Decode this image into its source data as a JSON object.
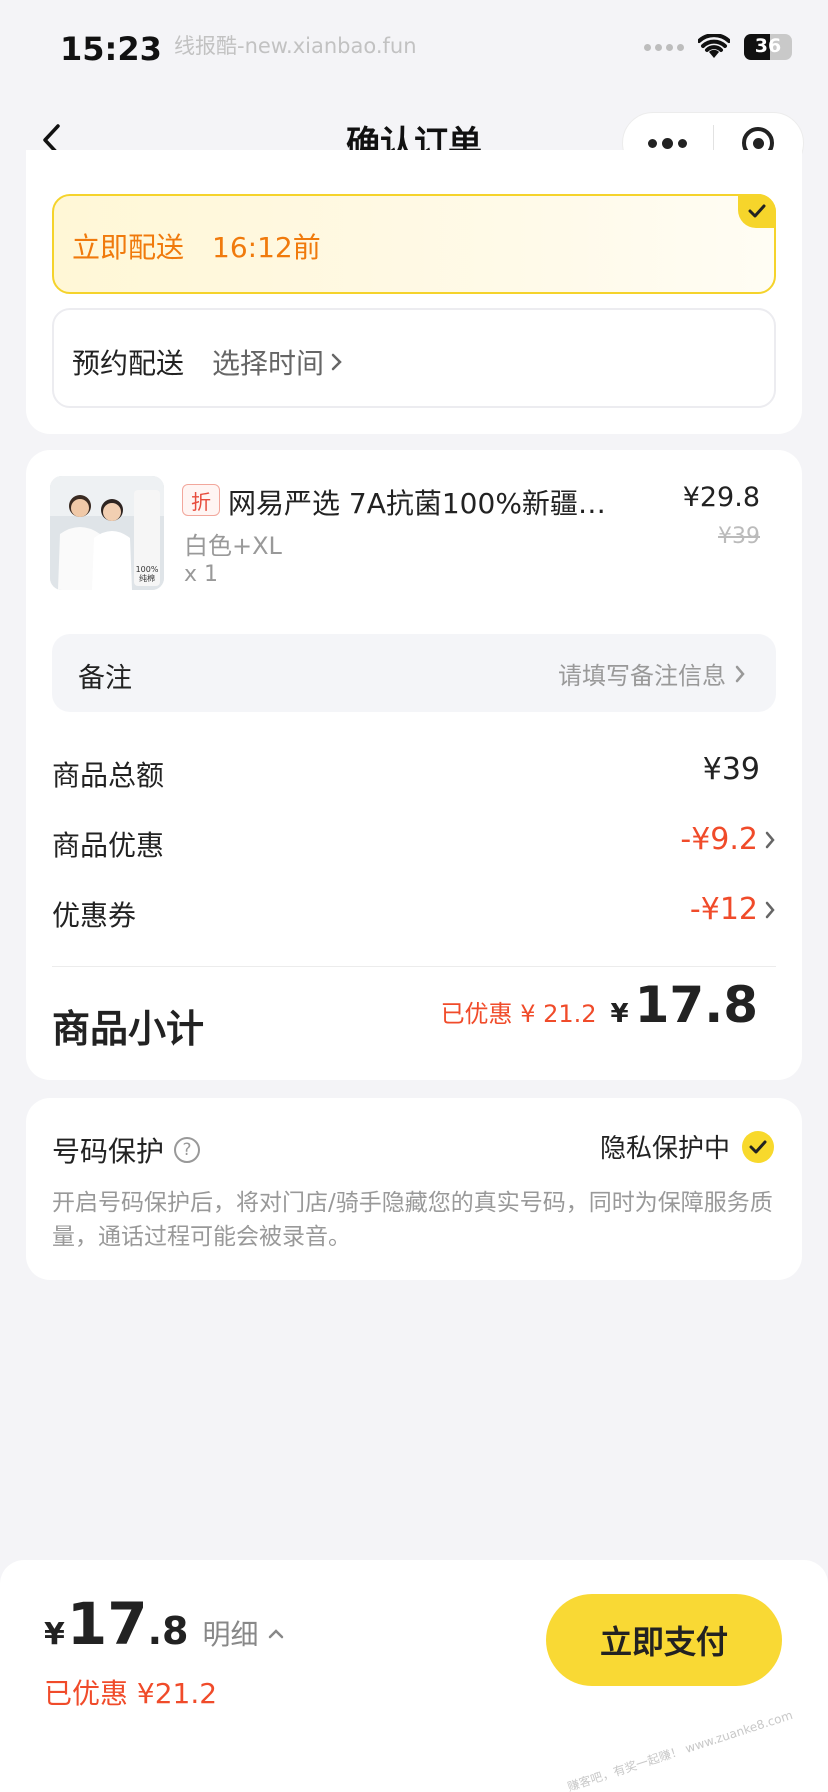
{
  "status_bar": {
    "time": "15:23",
    "watermark": "线报酷-new.xianbao.fun",
    "battery": "36"
  },
  "nav": {
    "title": "确认订单",
    "icons": [
      "back-chevron-icon",
      "more-dots-icon",
      "target-icon"
    ]
  },
  "delivery": {
    "instant": {
      "label": "立即配送",
      "time": "16:12前",
      "selected": true
    },
    "schedule": {
      "label": "预约配送",
      "time": "选择时间"
    }
  },
  "product": {
    "tag": "折",
    "name": "网易严选 7A抗菌100%新疆…",
    "spec": "白色+XL",
    "qty": "x 1",
    "price": "¥29.8",
    "original_price": "¥39",
    "image_texts": [
      "100%",
      "纯棉"
    ]
  },
  "remark": {
    "label": "备注",
    "placeholder": "请填写备注信息"
  },
  "fees": {
    "total_label": "商品总额",
    "total_value": "¥39",
    "discount_label": "商品优惠",
    "discount_value": "-¥9.2",
    "coupon_label": "优惠券",
    "coupon_value": "-¥12"
  },
  "subtotal": {
    "label": "商品小计",
    "saved": "已优惠 ¥ 21.2",
    "yen": "¥",
    "amount": "17.8"
  },
  "privacy": {
    "title": "号码保护",
    "help": "?",
    "status": "隐私保护中",
    "desc": "开启号码保护后，将对门店/骑手隐藏您的真实号码，同时为保障服务质量，通话过程可能会被录音。"
  },
  "bottom_bar": {
    "yen": "¥",
    "total_int": "17",
    "total_dec": ".8",
    "detail": "明细",
    "saved": "已优惠 ¥21.2",
    "pay_label": "立即支付",
    "watermark": "赚客吧，有奖一起赚！ www.zuanke8.com"
  },
  "colors": {
    "accent_yellow": "#f9d934",
    "orange": "#f07a0c",
    "red": "#f04b2a",
    "background": "#f4f4f7"
  }
}
